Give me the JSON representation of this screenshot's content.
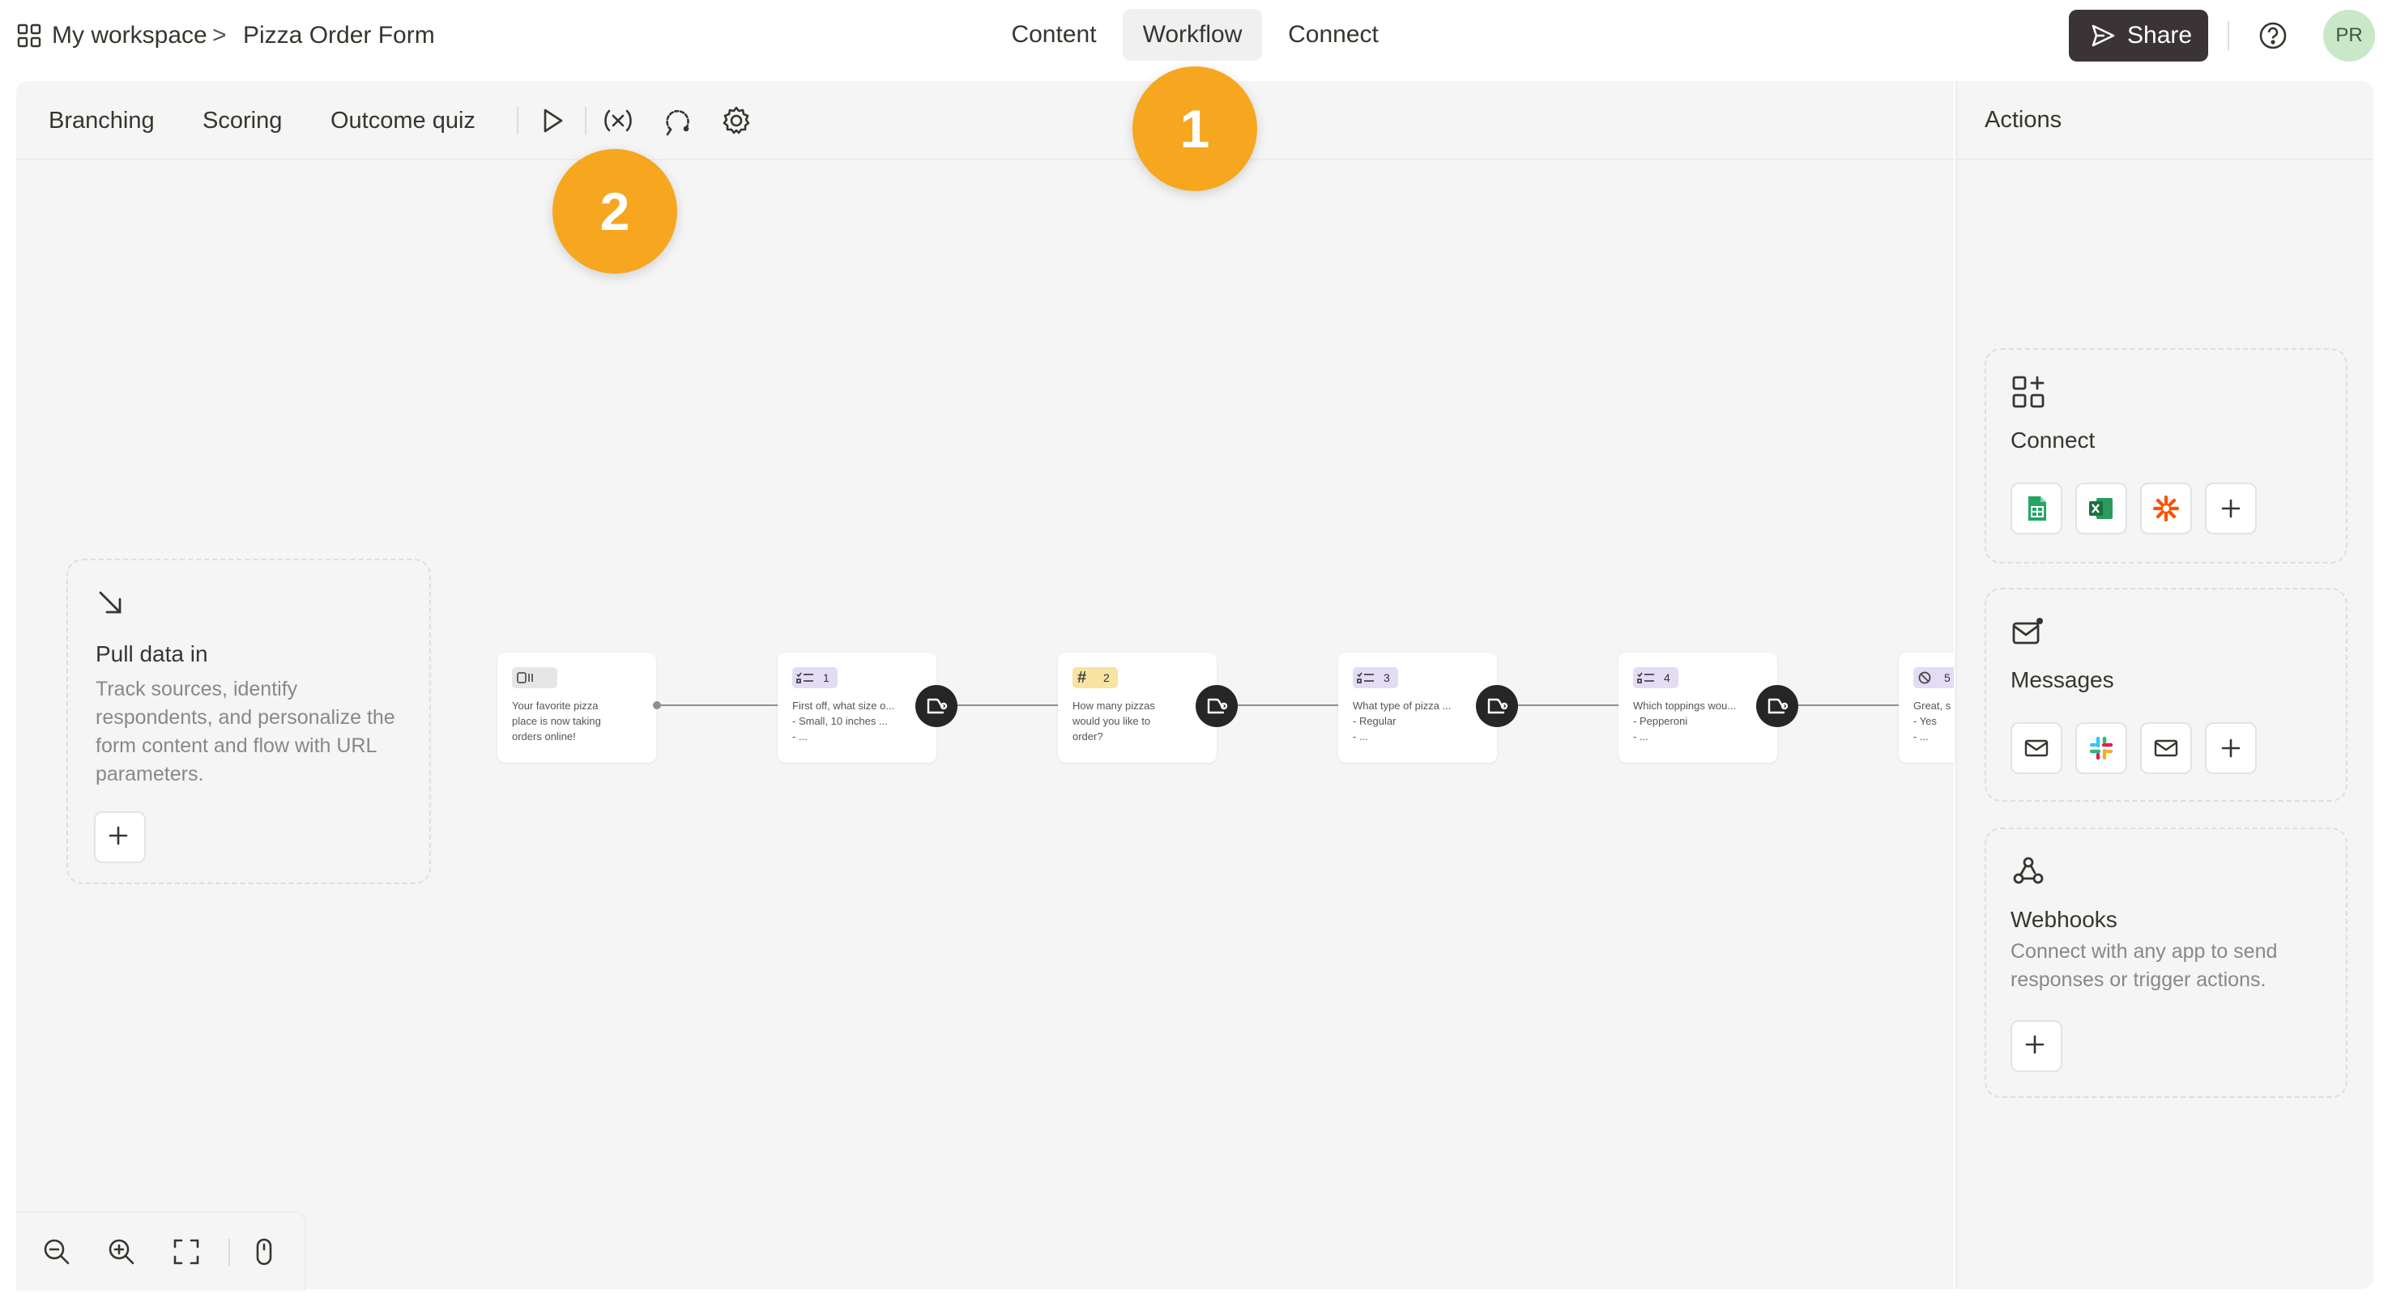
{
  "breadcrumb": {
    "workspace": "My workspace",
    "separator": ">",
    "form": "Pizza Order Form"
  },
  "nav_tabs": [
    {
      "label": "Content",
      "active": false
    },
    {
      "label": "Workflow",
      "active": true
    },
    {
      "label": "Connect",
      "active": false
    }
  ],
  "share_label": "Share",
  "avatar_initials": "PR",
  "canvas_toolbar": {
    "tabs": [
      "Branching",
      "Scoring",
      "Outcome quiz"
    ]
  },
  "pull_data": {
    "title": "Pull data in",
    "description": "Track sources, identify respondents, and personalize the form content and flow with URL parameters."
  },
  "nodes": [
    {
      "badge": "",
      "lines": [
        "Your favorite pizza",
        "place is now taking",
        "orders online!"
      ]
    },
    {
      "badge": "1",
      "lines": [
        "First off, what size o...",
        "- Small, 10 inches ...",
        "- ..."
      ]
    },
    {
      "badge": "2",
      "lines": [
        "How many pizzas",
        "would you like to",
        "order?"
      ]
    },
    {
      "badge": "3",
      "lines": [
        "What type of pizza ...",
        "- Regular",
        "- ..."
      ]
    },
    {
      "badge": "4",
      "lines": [
        "Which toppings wou...",
        "- Pepperoni",
        "- ..."
      ]
    },
    {
      "badge": "5",
      "lines": [
        "Great, s",
        "- Yes",
        "- ..."
      ]
    }
  ],
  "markers": [
    "1",
    "2"
  ],
  "actions": {
    "header": "Actions",
    "connect": {
      "title": "Connect"
    },
    "messages": {
      "title": "Messages"
    },
    "webhooks": {
      "title": "Webhooks",
      "description": "Connect with any app to send responses or trigger actions."
    }
  },
  "colors": {
    "marker": "#f6a71f",
    "share_button": "#3a3436",
    "avatar_bg": "#c9e8c8",
    "badge_choice": "#e4dcf5",
    "badge_number": "#f8e3a0",
    "sheets_green": "#23a566",
    "excel_green": "#1d6f42",
    "zapier_orange": "#ff4f00"
  },
  "icons": {
    "workspace": "grid-icon",
    "play": "play-icon",
    "variables": "variable-icon",
    "logic": "logic-icon",
    "settings": "gear-icon",
    "help": "help-icon",
    "zoom_out": "zoom-out-icon",
    "zoom_in": "zoom-in-icon",
    "fit": "fit-screen-icon",
    "mouse": "mouse-icon"
  }
}
